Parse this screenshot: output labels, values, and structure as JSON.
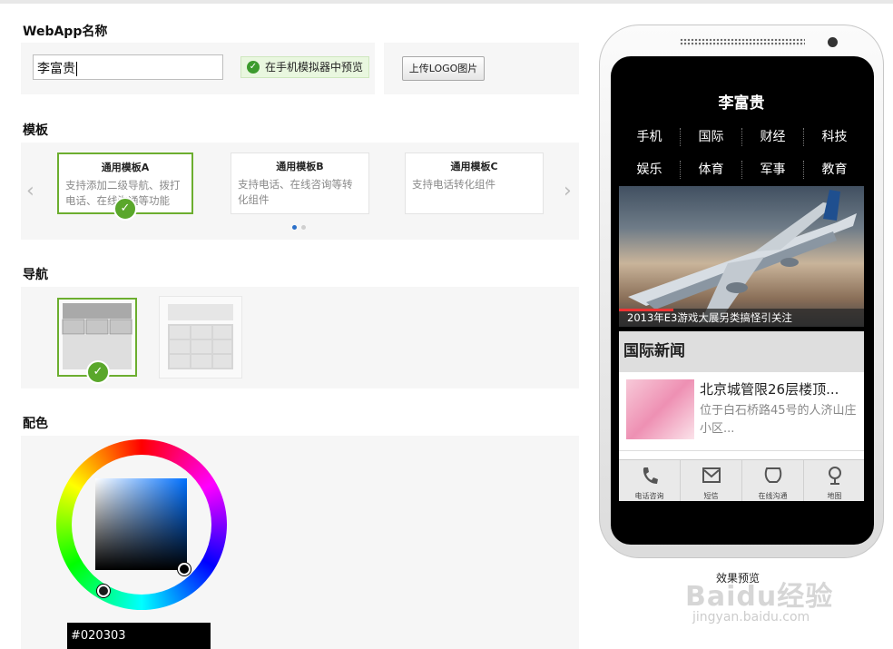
{
  "name_section": {
    "title": "WebApp名称",
    "input_value": "李富贵",
    "preview_label": "在手机模拟器中预览",
    "upload_label": "上传LOGO图片"
  },
  "template_section": {
    "title": "模板",
    "templates": [
      {
        "title": "通用模板A",
        "desc": "支持添加二级导航、拨打电话、在线沟通等功能",
        "selected": true
      },
      {
        "title": "通用模板B",
        "desc": "支持电话、在线咨询等转化组件",
        "selected": false
      },
      {
        "title": "通用模板C",
        "desc": "支持电话转化组件",
        "selected": false
      }
    ],
    "prev_arrow": "‹",
    "next_arrow": "›"
  },
  "nav_section": {
    "title": "导航"
  },
  "color_section": {
    "title": "配色",
    "value": "#020303"
  },
  "phone": {
    "title": "李富贵",
    "nav_items": [
      "手机",
      "国际",
      "财经",
      "科技",
      "娱乐",
      "体育",
      "军事",
      "教育"
    ],
    "banner_caption": "2013年E3游戏大展另类搞怪引关注",
    "section_title": "国际新闻",
    "news": {
      "title": "北京城管限26层楼顶...",
      "desc": "位于白石桥路45号的人济山庄小区..."
    },
    "bottom_items": [
      {
        "label": "电话咨询",
        "icon": "phone-icon"
      },
      {
        "label": "短信",
        "icon": "sms-icon"
      },
      {
        "label": "在线沟通",
        "icon": "chat-icon"
      },
      {
        "label": "地图",
        "icon": "map-pin-icon"
      }
    ]
  },
  "effect_label": "效果预览",
  "watermark": {
    "text": "Baidu经验",
    "url": "jingyan.baidu.com"
  },
  "colors": {
    "accent_green": "#6cae2f",
    "selected_color": "#020303",
    "panel_bg": "#f6f6f6"
  }
}
